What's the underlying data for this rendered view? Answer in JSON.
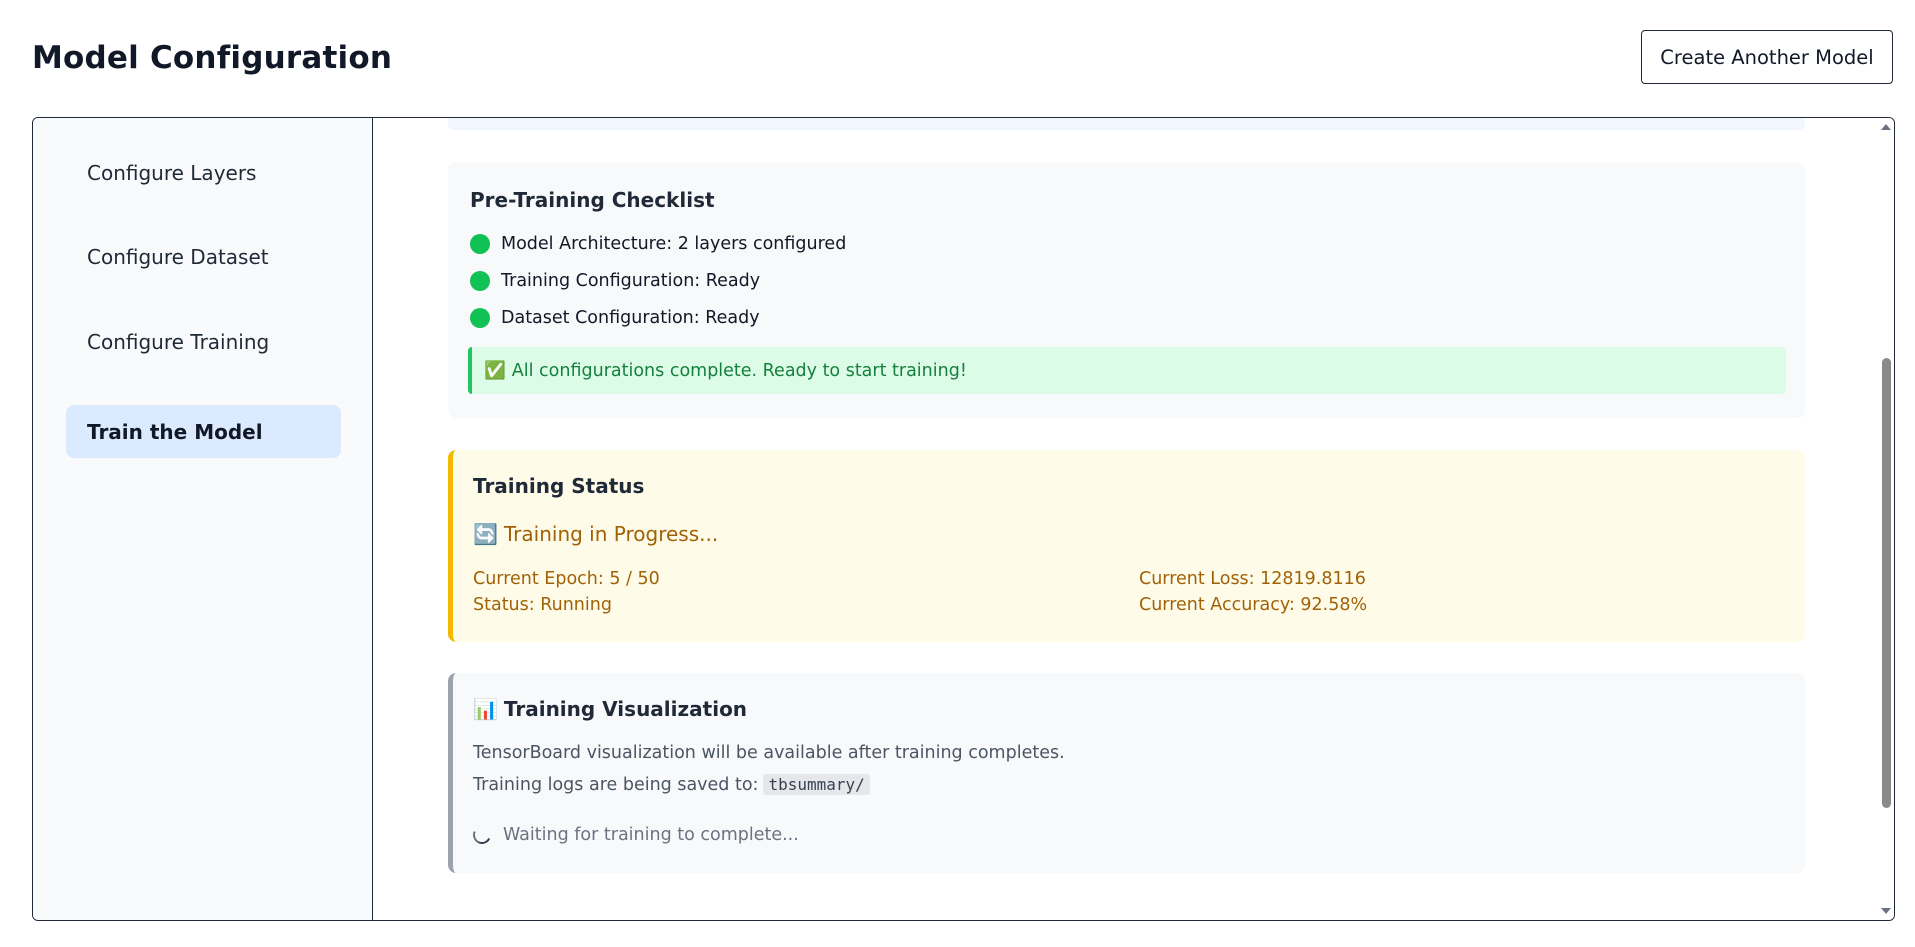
{
  "header": {
    "title": "Model Configuration",
    "create_button_label": "Create Another Model"
  },
  "sidebar": {
    "items": [
      {
        "label": "Configure Layers",
        "active": false
      },
      {
        "label": "Configure Dataset",
        "active": false
      },
      {
        "label": "Configure Training",
        "active": false
      },
      {
        "label": "Train the Model",
        "active": true
      }
    ]
  },
  "checklist": {
    "title": "Pre-Training Checklist",
    "items": [
      {
        "label": "Model Architecture: 2 layers configured",
        "status_color": "#10c153"
      },
      {
        "label": "Training Configuration: Ready",
        "status_color": "#10c153"
      },
      {
        "label": "Dataset Configuration: Ready",
        "status_color": "#10c153"
      }
    ],
    "success_icon": "✅",
    "success_message": "All configurations complete. Ready to start training!"
  },
  "training_status": {
    "title": "Training Status",
    "progress_icon": "🔄",
    "progress_label": "Training in Progress...",
    "current_epoch": "Current Epoch: 5 / 50",
    "status": "Status: Running",
    "current_loss": "Current Loss: 12819.8116",
    "current_accuracy": "Current Accuracy: 92.58%"
  },
  "visualization": {
    "title_icon": "📊",
    "title": "Training Visualization",
    "availability_text": "TensorBoard visualization will be available after training completes.",
    "logs_text": "Training logs are being saved to:",
    "logs_path": "tbsummary/",
    "waiting_text": "Waiting for training to complete..."
  },
  "colors": {
    "accent_active": "#dbeafe",
    "success": "#22c55e",
    "warning_border": "#f5b800",
    "warning_text": "#a16207"
  }
}
